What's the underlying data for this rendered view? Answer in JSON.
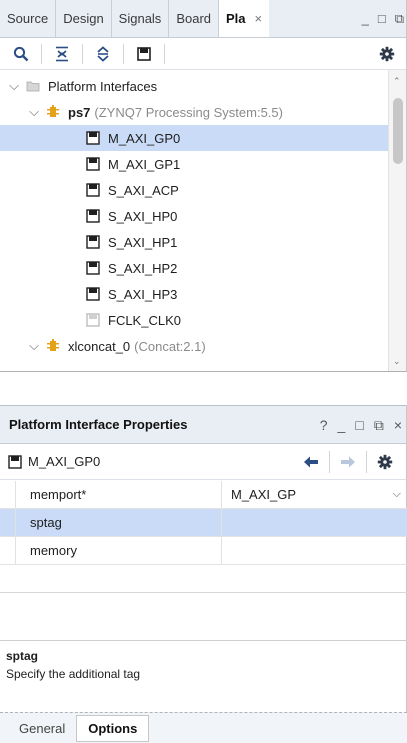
{
  "top": {
    "tabs": [
      {
        "label": "Source"
      },
      {
        "label": "Design"
      },
      {
        "label": "Signals"
      },
      {
        "label": "Board"
      },
      {
        "label": "Pla"
      }
    ],
    "tree": {
      "root": "Platform Interfaces",
      "ps7": {
        "name": "ps7",
        "detail": "(ZYNQ7 Processing System:5.5)"
      },
      "items": [
        {
          "label": "M_AXI_GP0",
          "selected": true
        },
        {
          "label": "M_AXI_GP1"
        },
        {
          "label": "S_AXI_ACP"
        },
        {
          "label": "S_AXI_HP0"
        },
        {
          "label": "S_AXI_HP1"
        },
        {
          "label": "S_AXI_HP2"
        },
        {
          "label": "S_AXI_HP3"
        },
        {
          "label": "FCLK_CLK0"
        }
      ],
      "xlconcat": {
        "name": "xlconcat_0",
        "detail": "(Concat:2.1)"
      }
    }
  },
  "bottom": {
    "title": "Platform Interface Properties",
    "ctrls": {
      "help": "?",
      "min": "_",
      "max": "□",
      "restore": "⧉",
      "close": "×"
    },
    "selected_name": "M_AXI_GP0",
    "properties": [
      {
        "name": "memport*",
        "value": "M_AXI_GP",
        "dropdown": true
      },
      {
        "name": "sptag",
        "value": "",
        "selected": true
      },
      {
        "name": "memory",
        "value": ""
      }
    ],
    "description": {
      "title": "sptag",
      "text": "Specify the additional tag"
    },
    "tabs": [
      {
        "label": "General"
      },
      {
        "label": "Options",
        "active": true
      }
    ]
  },
  "colors": {
    "accent": "#3d6fb6",
    "selection": "#c9dbf7",
    "header_bg": "#e9eef5"
  }
}
